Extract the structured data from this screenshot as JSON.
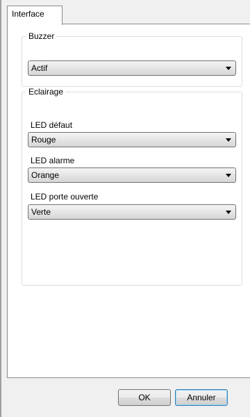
{
  "tabs": [
    {
      "label": "Interface"
    }
  ],
  "buzzer": {
    "legend": "Buzzer",
    "value": "Actif"
  },
  "eclairage": {
    "legend": "Eclairage",
    "led_defaut": {
      "label": "LED défaut",
      "value": "Rouge"
    },
    "led_alarme": {
      "label": "LED alarme",
      "value": "Orange"
    },
    "led_porte": {
      "label": "LED porte ouverte",
      "value": "Verte"
    }
  },
  "buttons": {
    "ok": "OK",
    "cancel": "Annuler"
  }
}
